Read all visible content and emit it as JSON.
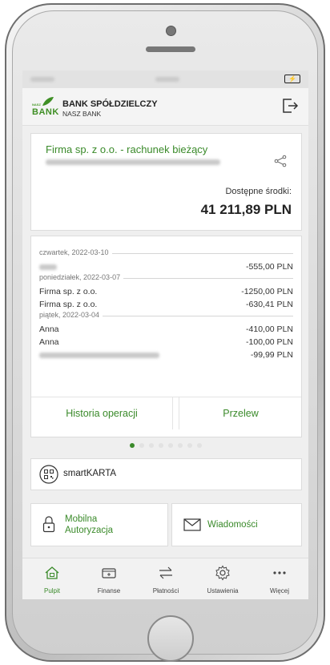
{
  "status_bar": {
    "battery_icon": "battery-charging-icon"
  },
  "header": {
    "brand_top": "NASZ",
    "brand_word": "BANK",
    "bank_name": "BANK SPÓŁDZIELCZY",
    "bank_subtitle": "NASZ BANK",
    "logout_icon": "logout-icon"
  },
  "account": {
    "name": "Firma sp. z o.o. - rachunek bieżący",
    "available_label": "Dostępne środki:",
    "available_amount": "41 211,89 PLN",
    "share_icon": "share-icon"
  },
  "transactions": {
    "groups": [
      {
        "date": "czwartek, 2022-03-10",
        "items": [
          {
            "name": "",
            "amount": "-555,00 PLN"
          }
        ]
      },
      {
        "date": "poniedziałek, 2022-03-07",
        "items": [
          {
            "name": "Firma sp. z o.o.",
            "amount": "-1250,00 PLN"
          },
          {
            "name": "Firma sp. z o.o.",
            "amount": "-630,41 PLN"
          }
        ]
      },
      {
        "date": "piątek, 2022-03-04",
        "items": [
          {
            "name": "Anna",
            "amount": "-410,00 PLN"
          },
          {
            "name": "Anna",
            "amount": "-100,00 PLN"
          },
          {
            "name": "",
            "amount": "-99,99 PLN"
          }
        ]
      }
    ],
    "history_button": "Historia operacji",
    "transfer_button": "Przelew"
  },
  "pager": {
    "count": 8,
    "active_index": 0
  },
  "smartkarta": {
    "label": "smartKARTA"
  },
  "mobile_auth": {
    "label_line1": "Mobilna",
    "label_line2": "Autoryzacja"
  },
  "messages": {
    "label": "Wiadomości"
  },
  "tabs": [
    {
      "label": "Pulpit",
      "icon": "home-icon",
      "active": true
    },
    {
      "label": "Finanse",
      "icon": "wallet-icon",
      "active": false
    },
    {
      "label": "Płatności",
      "icon": "transfer-arrows-icon",
      "active": false
    },
    {
      "label": "Ustawienia",
      "icon": "gear-icon",
      "active": false
    },
    {
      "label": "Więcej",
      "icon": "more-icon",
      "active": false
    }
  ],
  "colors": {
    "accent": "#3a8a2a",
    "background": "#efefef"
  }
}
